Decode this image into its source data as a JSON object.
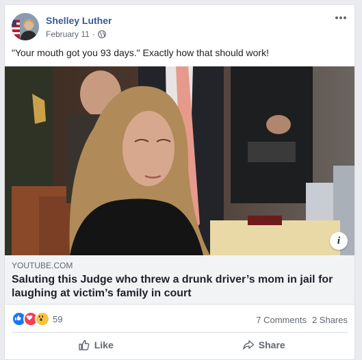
{
  "post": {
    "author": "Shelley Luther",
    "date": "February 11",
    "date_separator": "·",
    "privacy_icon": "globe-icon",
    "text": "\"Your mouth got you 93 days.\" Exactly how that should work!",
    "more_icon": "more-options-icon"
  },
  "link": {
    "domain": "YOUTUBE.COM",
    "title": "Saluting this Judge who threw a drunk driver’s mom in jail for laughing at victim’s family in court",
    "info_label": "i"
  },
  "stats": {
    "reaction_types": [
      "like",
      "love",
      "wow"
    ],
    "reaction_count": "59",
    "comments": "7 Comments",
    "shares": "2 Shares"
  },
  "actions": {
    "like_label": "Like",
    "share_label": "Share"
  },
  "colors": {
    "author_link": "#385898",
    "like_blue": "#1877f2",
    "love_red": "#f33e58",
    "wow_yellow": "#f7c33b"
  }
}
